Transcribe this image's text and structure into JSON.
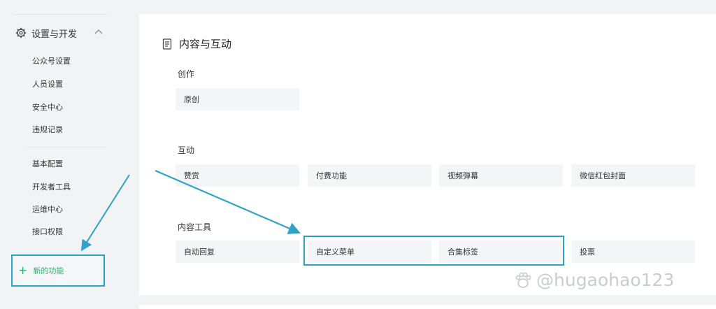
{
  "sidebar": {
    "section_title": "设置与开发",
    "items_a": [
      "公众号设置",
      "人员设置",
      "安全中心",
      "违规记录"
    ],
    "items_b": [
      "基本配置",
      "开发者工具",
      "运维中心",
      "接口权限"
    ],
    "new_feature": "新的功能"
  },
  "main": {
    "title": "内容与互动",
    "groups": {
      "create": {
        "title": "创作",
        "items": [
          "原创"
        ]
      },
      "interact": {
        "title": "互动",
        "items": [
          "赞赏",
          "付费功能",
          "视频弹幕",
          "微信红包封面"
        ]
      },
      "tools": {
        "title": "内容工具",
        "items": [
          "自动回复",
          "自定义菜单",
          "合集标签",
          "投票"
        ]
      }
    }
  },
  "watermark": "@hugaohao123",
  "colors": {
    "accent_green": "#27b36b",
    "annotation_blue": "#2fa3c7",
    "card_bg": "#f4f5f7"
  }
}
